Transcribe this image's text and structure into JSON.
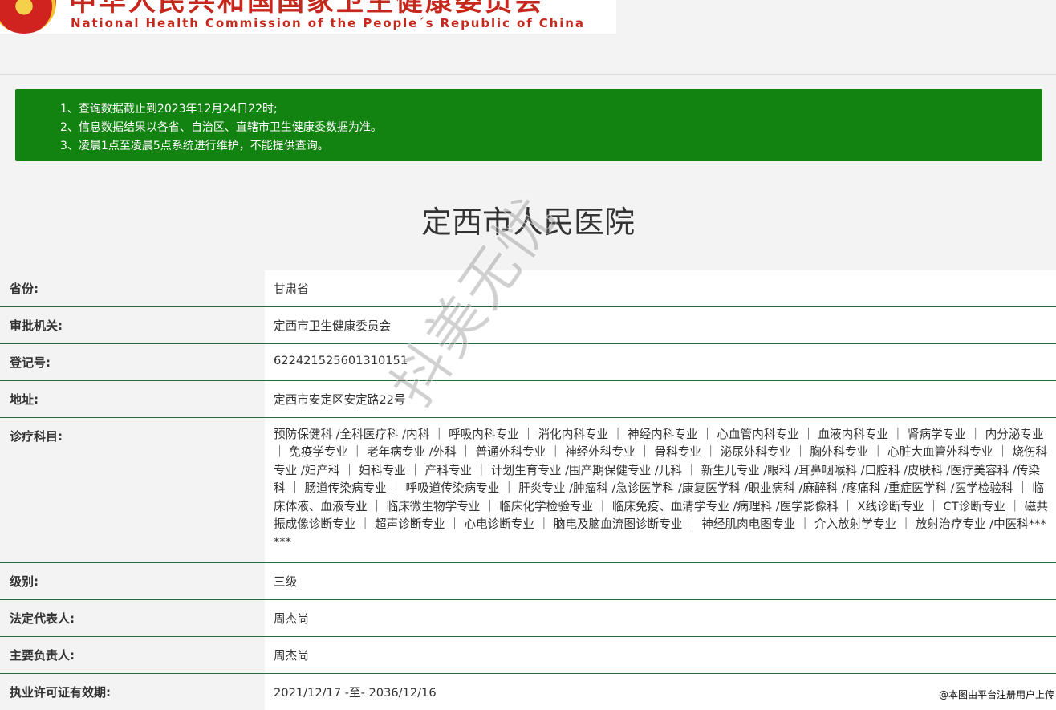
{
  "header": {
    "title_cn": "中华人民共和国国家卫生健康委员会",
    "title_en": "National Health Commission of the People´s Republic of China",
    "emblem_icon": "national-emblem-icon"
  },
  "notice": {
    "line1": "1、查询数据截止到2023年12月24日22时;",
    "line2": "2、信息数据结果以各省、自治区、直辖市卫生健康委数据为准。",
    "line3": "3、凌晨1点至凌晨5点系统进行维护，不能提供查询。",
    "background_color": "#128211"
  },
  "hospital": {
    "name": "定西市人民医院"
  },
  "fields": {
    "province": {
      "label": "省份:",
      "value": "甘肃省"
    },
    "authority": {
      "label": "审批机关:",
      "value": "定西市卫生健康委员会"
    },
    "reg_no": {
      "label": "登记号:",
      "value": "622421525601310151"
    },
    "address": {
      "label": "地址:",
      "value": "定西市安定区安定路22号"
    },
    "departments": {
      "label": "诊疗科目:",
      "value": "预防保健科 /全科医疗科 /内科 ｜ 呼吸内科专业 ｜ 消化内科专业 ｜ 神经内科专业 ｜ 心血管内科专业 ｜ 血液内科专业 ｜ 肾病学专业 ｜ 内分泌专业 ｜ 免疫学专业 ｜ 老年病专业 /外科 ｜ 普通外科专业 ｜ 神经外科专业 ｜ 骨科专业 ｜ 泌尿外科专业 ｜ 胸外科专业 ｜ 心脏大血管外科专业 ｜ 烧伤科专业 /妇产科 ｜ 妇科专业 ｜ 产科专业 ｜ 计划生育专业 /围产期保健专业 /儿科 ｜ 新生儿专业 /眼科 /耳鼻咽喉科 /口腔科 /皮肤科 /医疗美容科 /传染科 ｜ 肠道传染病专业 ｜ 呼吸道传染病专业 ｜ 肝炎专业 /肿瘤科 /急诊医学科 /康复医学科 /职业病科 /麻醉科 /疼痛科 /重症医学科 /医学检验科 ｜ 临床体液、血液专业 ｜ 临床微生物学专业 ｜ 临床化学检验专业 ｜ 临床免疫、血清学专业 /病理科 /医学影像科 ｜ X线诊断专业 ｜ CT诊断专业 ｜ 磁共振成像诊断专业 ｜ 超声诊断专业 ｜ 心电诊断专业 ｜ 脑电及脑血流图诊断专业 ｜ 神经肌肉电图专业 ｜ 介入放射学专业 ｜ 放射治疗专业 /中医科******"
    },
    "level": {
      "label": "级别:",
      "value": "三级"
    },
    "legal_rep": {
      "label": "法定代表人:",
      "value": "周杰尚"
    },
    "principal": {
      "label": "主要负责人:",
      "value": "周杰尚"
    },
    "license_validity": {
      "label": "执业许可证有效期:",
      "value": "2021/12/17 -至- 2036/12/16"
    }
  },
  "watermark": "抖美无忧",
  "credit": "@本图由平台注册用户上传"
}
